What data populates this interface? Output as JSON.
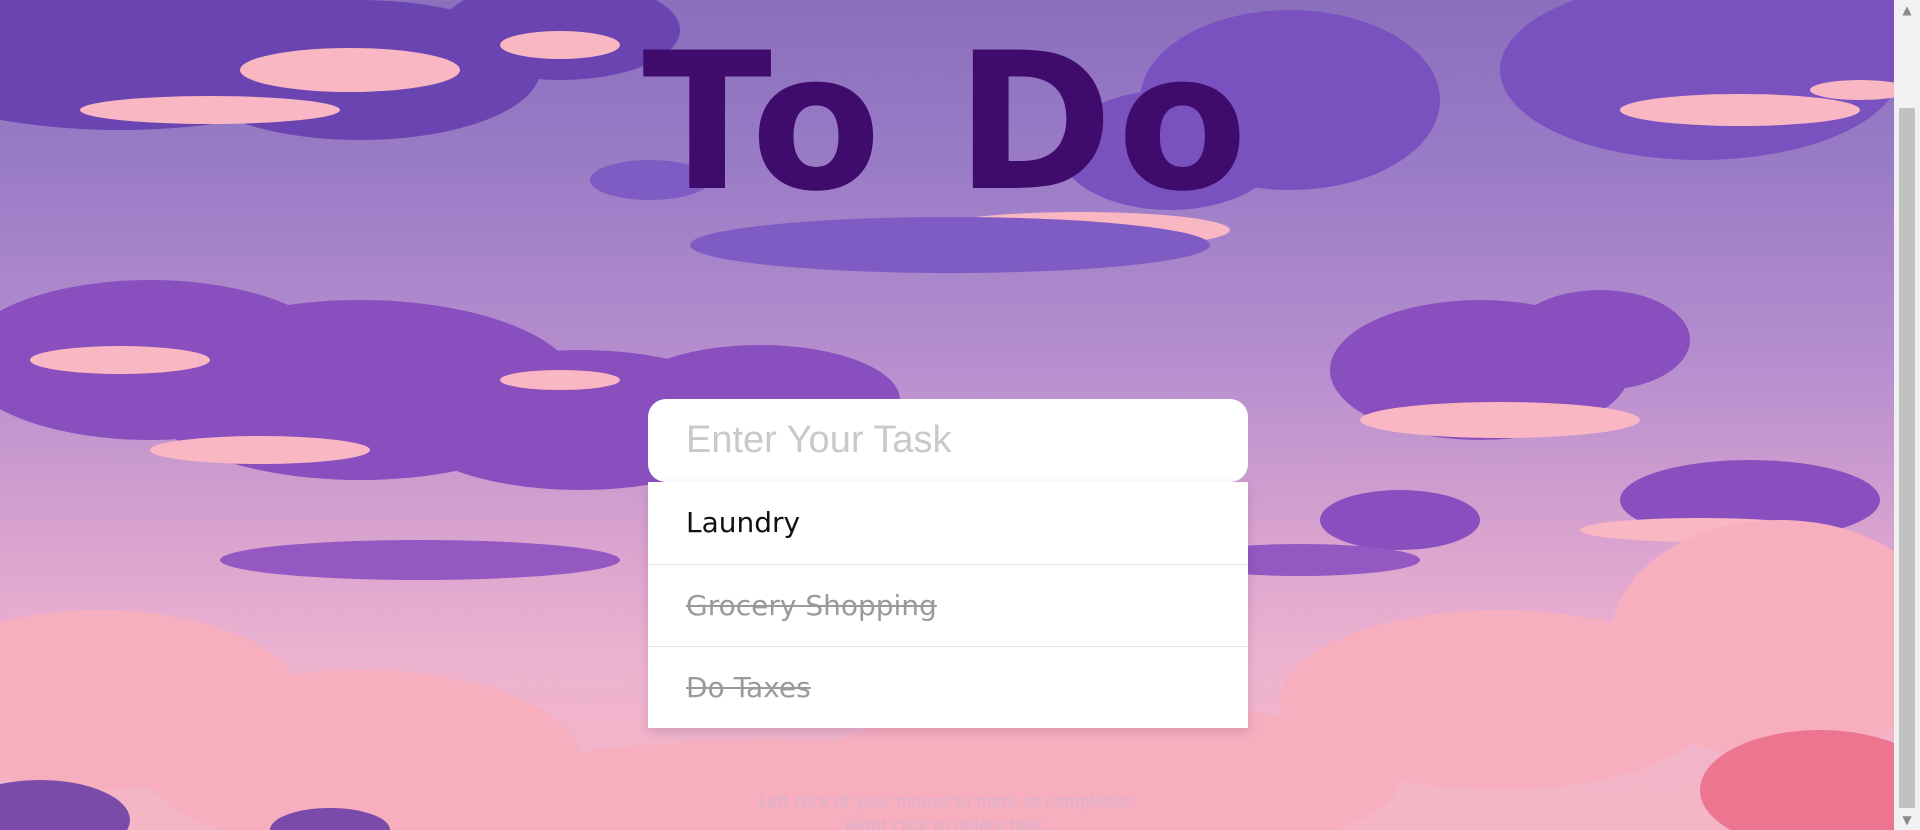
{
  "header": {
    "title": "To Do"
  },
  "task_input": {
    "placeholder": "Enter Your Task",
    "value": ""
  },
  "tasks": [
    {
      "label": "Laundry",
      "completed": false
    },
    {
      "label": "Grocery Shopping",
      "completed": true
    },
    {
      "label": "Do Taxes",
      "completed": true
    }
  ],
  "hint": {
    "line1": "Left click of your mouse to mark as completed.",
    "line2": "Right click to delete task."
  },
  "scrollbar": {
    "up_icon": "triangle-up-icon",
    "down_icon": "triangle-down-icon"
  },
  "colors": {
    "title": "#3f0c6e",
    "card": "#ffffff",
    "completed_text": "#9a9a9a",
    "sky_top": "#8a6fbd",
    "sky_bottom": "#f4b6c4"
  }
}
